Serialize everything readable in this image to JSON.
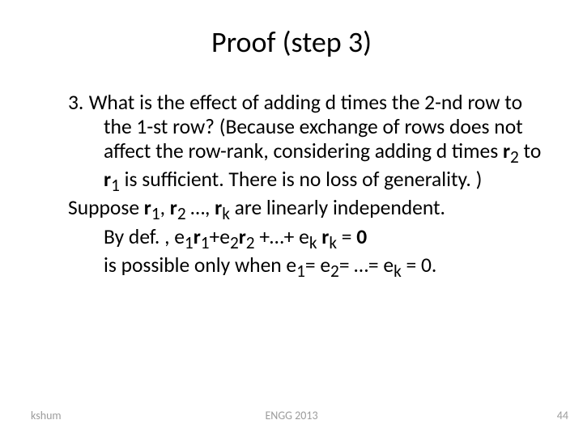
{
  "title": "Proof (step 3)",
  "bullet_num": "3.",
  "para1_seg1": "What is the effect of adding d times the 2-nd row to the 1-st row? (Because exchange of rows does not affect the row-rank, considering adding d times ",
  "para1_r2": "r",
  "para1_r2_sub": "2",
  "para1_seg2": " to ",
  "para1_r1": "r",
  "para1_r1_sub": "1",
  "para1_seg3": " is sufficient. There is no loss of generality. )",
  "suppose_pre": "Suppose ",
  "suppose_r1": "r",
  "suppose_r1_sub": "1",
  "suppose_sep1": ", ",
  "suppose_r2": "r",
  "suppose_r2_sub": "2",
  "suppose_ell": " …, ",
  "suppose_rk": "r",
  "suppose_rk_sub": "k",
  "suppose_post": " are linearly independent.",
  "bydef_pre": "By def. , e",
  "bydef_1a": "1",
  "bydef_r1": "r",
  "bydef_r1_sub": "1",
  "bydef_plus1": "+e",
  "bydef_2a": "2",
  "bydef_r2": "r",
  "bydef_r2_sub": "2",
  "bydef_plus_ell": " +…+ e",
  "bydef_k": "k",
  "bydef_sp": " ",
  "bydef_rk": "r",
  "bydef_rk_sub": "k",
  "bydef_eq": " = ",
  "bydef_zero": "0",
  "poss_pre": "is possible only when e",
  "poss_1": "1",
  "poss_eq1": "= e",
  "poss_2": "2",
  "poss_eq2": "= …= e",
  "poss_k": "k",
  "poss_end": " = 0.",
  "footer_left": "kshum",
  "footer_center": "ENGG 2013",
  "footer_right": "44"
}
